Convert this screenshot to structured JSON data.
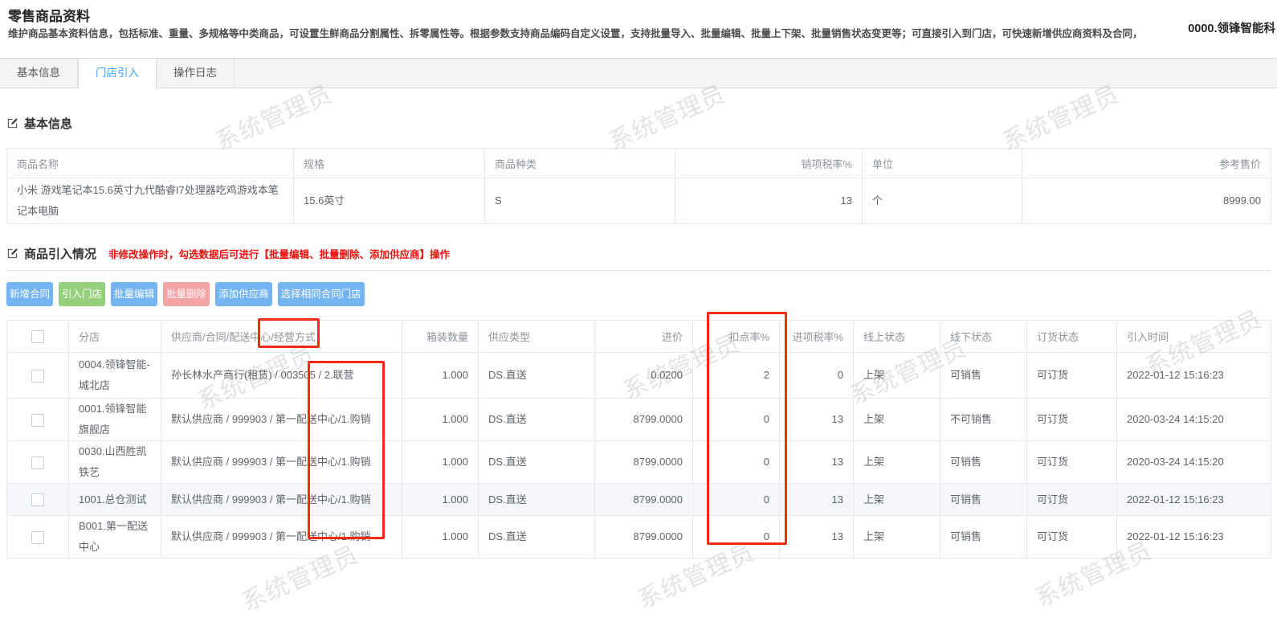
{
  "header": {
    "title": "零售商品资料",
    "description": "维护商品基本资料信息，包括标准、重量、多规格等中类商品，可设置生鲜商品分割属性、拆零属性等。根据参数支持商品编码自定义设置，支持批量导入、批量编辑、批量上下架、批量销售状态变更等；可直接引入到门店，可快速新增供应商资料及合同，",
    "company": "0000.领锋智能科"
  },
  "tabs": [
    {
      "label": "基本信息"
    },
    {
      "label": "门店引入"
    },
    {
      "label": "操作日志"
    }
  ],
  "active_tab": "门店引入",
  "watermark": "系统管理员",
  "colors": {
    "accent_blue": "#409eff",
    "button_blue": "#74b4f2",
    "button_green": "#97d07d",
    "button_pink": "#f2a3a3",
    "warning_red": "#f20b0b",
    "annotation_red": "#f42a12"
  },
  "basic_info": {
    "section_title": "基本信息",
    "columns": [
      "商品名称",
      "规格",
      "商品种类",
      "销项税率%",
      "单位",
      "参考售价"
    ],
    "row": {
      "name": "小米 游戏笔记本15.6英寸九代酷睿I7处理器吃鸡游戏本笔记本电脑",
      "spec": "15.6英寸",
      "category": "S",
      "output_tax_rate": "13",
      "unit": "个",
      "reference_price": "8999.00"
    }
  },
  "import_section": {
    "section_title": "商品引入情况",
    "warning": "非修改操作时，勾选数据后可进行【批量编辑、批量删除、添加供应商】操作",
    "buttons": [
      {
        "label": "新增合同",
        "color": "blue"
      },
      {
        "label": "引入门店",
        "color": "green"
      },
      {
        "label": "批量编辑",
        "color": "blue"
      },
      {
        "label": "批量删除",
        "color": "pink"
      },
      {
        "label": "添加供应商",
        "color": "blue"
      },
      {
        "label": "选择相同合同门店",
        "color": "blue"
      }
    ],
    "table": {
      "columns": [
        "分店",
        "供应商/合同/配送中心/经营方式",
        "箱装数量",
        "供应类型",
        "进价",
        "扣点率%",
        "进项税率%",
        "线上状态",
        "线下状态",
        "订货状态",
        "引入时间"
      ],
      "rows": [
        {
          "store": "0004.领锋智能-城北店",
          "supplier": "孙长林水产商行(租赁) / 003505 / 2.联营",
          "box_qty": "1.000",
          "supply_type": "DS.直送",
          "purchase_price": "0.0200",
          "deduction_rate": "2",
          "input_tax_rate": "0",
          "online_status": "上架",
          "offline_status": "可销售",
          "order_status": "可订货",
          "import_time": "2022-01-12 15:16:23"
        },
        {
          "store": "0001.领锋智能旗舰店",
          "supplier": "默认供应商 / 999903 / 第一配送中心/1.购销",
          "box_qty": "1.000",
          "supply_type": "DS.直送",
          "purchase_price": "8799.0000",
          "deduction_rate": "0",
          "input_tax_rate": "13",
          "online_status": "上架",
          "offline_status": "不可销售",
          "order_status": "可订货",
          "import_time": "2020-03-24 14:15:20"
        },
        {
          "store": "0030.山西胜凯铁艺",
          "supplier": "默认供应商 / 999903 / 第一配送中心/1.购销",
          "box_qty": "1.000",
          "supply_type": "DS.直送",
          "purchase_price": "8799.0000",
          "deduction_rate": "0",
          "input_tax_rate": "13",
          "online_status": "上架",
          "offline_status": "可销售",
          "order_status": "可订货",
          "import_time": "2020-03-24 14:15:20"
        },
        {
          "store": "1001.总仓测试",
          "supplier": "默认供应商 / 999903 / 第一配送中心/1.购销",
          "box_qty": "1.000",
          "supply_type": "DS.直送",
          "purchase_price": "8799.0000",
          "deduction_rate": "0",
          "input_tax_rate": "13",
          "online_status": "上架",
          "offline_status": "可销售",
          "order_status": "可订货",
          "import_time": "2022-01-12 15:16:23"
        },
        {
          "store": "B001.第一配送中心",
          "supplier": "默认供应商 / 999903 / 第一配送中心/1.购销",
          "box_qty": "1.000",
          "supply_type": "DS.直送",
          "purchase_price": "8799.0000",
          "deduction_rate": "0",
          "input_tax_rate": "13",
          "online_status": "上架",
          "offline_status": "可销售",
          "order_status": "可订货",
          "import_time": "2022-01-12 15:16:23"
        }
      ]
    }
  }
}
